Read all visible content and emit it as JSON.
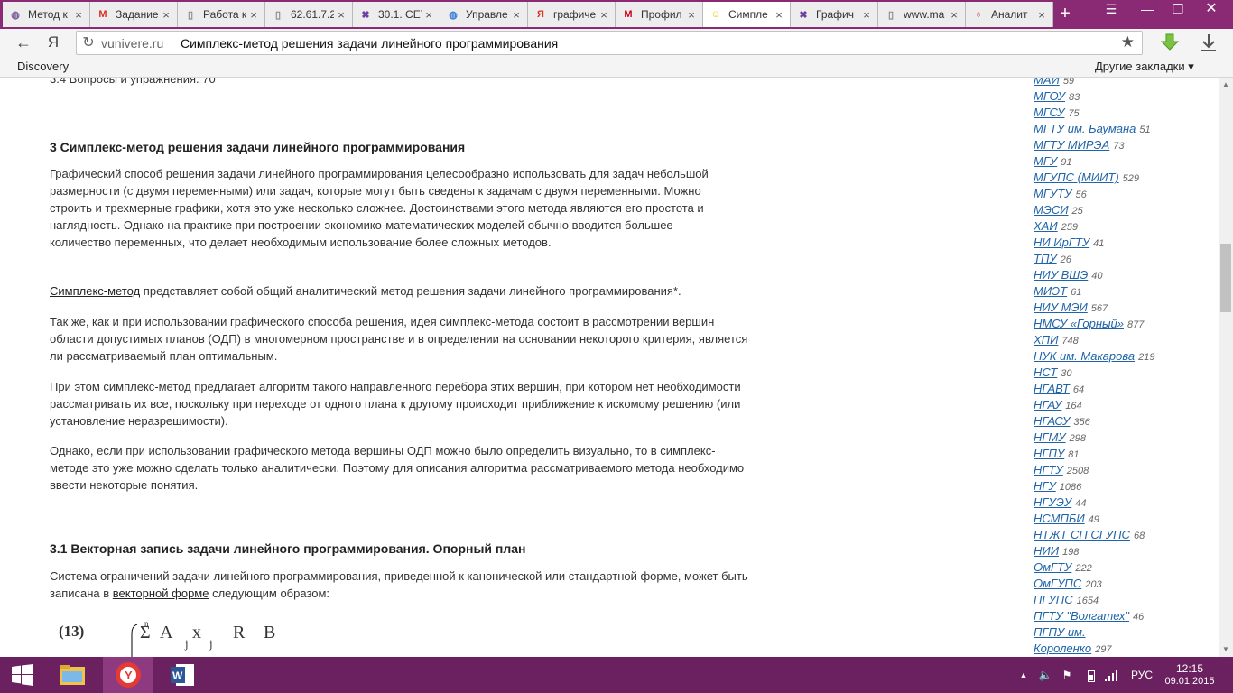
{
  "tabs": [
    {
      "label": "Метод к",
      "icon": "globe-icon",
      "icon_color": "#7a5a9a"
    },
    {
      "label": "Задание",
      "icon": "gmail-icon",
      "icon_color": "#d93025"
    },
    {
      "label": "Работа к",
      "icon": "page-icon",
      "icon_color": "#888888"
    },
    {
      "label": "62.61.7.2",
      "icon": "page-icon",
      "icon_color": "#888888"
    },
    {
      "label": "30.1. СЕТ",
      "icon": "x-brand-icon",
      "icon_color": "#6a3fa0"
    },
    {
      "label": "Управле",
      "icon": "globe-icon",
      "icon_color": "#3a7bd5"
    },
    {
      "label": "графиче",
      "icon": "yandex-icon",
      "icon_color": "#d9342b"
    },
    {
      "label": "Профил",
      "icon": "m-brand-icon",
      "icon_color": "#d0021b"
    },
    {
      "label": "Симпле",
      "icon": "smiley-icon",
      "icon_color": "#f2c200",
      "active": true
    },
    {
      "label": "Графич",
      "icon": "x-brand-icon",
      "icon_color": "#6a3fa0"
    },
    {
      "label": "www.ma",
      "icon": "page-icon",
      "icon_color": "#888888"
    },
    {
      "label": "Аналит",
      "icon": "mouse-icon",
      "icon_color": "#c62828"
    }
  ],
  "toolbar": {
    "back": "←",
    "yandex_letter": "Я",
    "refresh": "↻",
    "domain": "vunivere.ru",
    "page_title": "Симплекс-метод решения задачи линейного программирования",
    "star": "★"
  },
  "bookmarks": {
    "left": "Discovery",
    "right": "Другие закладки ▾"
  },
  "article": {
    "top_partial": "3.4 Вопросы и упражнения. 70",
    "h1": "3 Симплекс-метод решения задачи линейного программирования",
    "p1": "Графический способ решения задачи линейного программирования целесообразно использовать для задач небольшой размерности (с двумя переменными) или задач, которые могут быть сведены к задачам с двумя переменными. Можно строить и трехмерные графики, хотя это уже несколько сложнее. Достоинствами этого метода являются его простота и наглядность. Однако на практике при построении экономико-математических моделей обычно вводится большее количество переменных, что делает необходимым использование более сложных методов.",
    "p2_link": "Симплекс-метод",
    "p2_rest": " представляет собой общий аналитический метод решения задачи линейного программирования*.",
    "p3": "Так же, как и при использовании графического способа решения, идея симплекс-метода состоит в рассмотрении вершин области допустимых планов (ОДП) в многомерном пространстве и в определении на основании некоторого критерия, является ли рассматриваемый план оптимальным.",
    "p4": "При этом симплекс-метод предлагает алгоритм такого направленного перебора этих вершин, при котором нет необходимости рассматривать их все, поскольку при переходе от одного плана к другому происходит приближение к искомому решению (или установление неразрешимости).",
    "p5": "Однако, если при использовании графического метода вершины ОДП можно было определить визуально, то в симплекс-методе это уже можно сделать только аналитически. Поэтому для описания алгоритма рассматриваемого метода необходимо ввести некоторые понятия.",
    "h2": "3.1 Векторная запись задачи линейного программирования. Опорный план",
    "p6_pre": "Система ограничений задачи линейного программирования, приведенной к канонической или стандартной форме, может быть записана в ",
    "p6_link": "векторной форме",
    "p6_post": " следующим образом:",
    "formula": {
      "num": "(13)",
      "n": "n",
      "sigma": "Σ",
      "a": "A",
      "j1": "j",
      "x": "x",
      "j2": "j",
      "r": "R",
      "b": "B"
    }
  },
  "sidebar": [
    {
      "name": "МАИ",
      "count": "59"
    },
    {
      "name": "МГОУ",
      "count": "83"
    },
    {
      "name": "МГСУ",
      "count": "75"
    },
    {
      "name": "МГТУ им. Баумана",
      "count": "51"
    },
    {
      "name": "МГТУ МИРЭА",
      "count": "73"
    },
    {
      "name": "МГУ",
      "count": "91"
    },
    {
      "name": "МГУПС (МИИТ)",
      "count": "529"
    },
    {
      "name": "МГУТУ",
      "count": "56"
    },
    {
      "name": "МЭСИ",
      "count": "25"
    },
    {
      "name": "ХАИ",
      "count": "259"
    },
    {
      "name": "НИ ИрГТУ",
      "count": "41"
    },
    {
      "name": "ТПУ",
      "count": "26"
    },
    {
      "name": "НИУ ВШЭ",
      "count": "40"
    },
    {
      "name": "МИЭТ",
      "count": "61"
    },
    {
      "name": "НИУ МЭИ",
      "count": "567"
    },
    {
      "name": "НМСУ «Горный»",
      "count": "877"
    },
    {
      "name": "ХПИ",
      "count": "748"
    },
    {
      "name": "НУК им. Макарова",
      "count": "219"
    },
    {
      "name": "НСТ",
      "count": "30"
    },
    {
      "name": "НГАВТ",
      "count": "64"
    },
    {
      "name": "НГАУ",
      "count": "164"
    },
    {
      "name": "НГАСУ",
      "count": "356"
    },
    {
      "name": "НГМУ",
      "count": "298"
    },
    {
      "name": "НГПУ",
      "count": "81"
    },
    {
      "name": "НГТУ",
      "count": "2508"
    },
    {
      "name": "НГУ",
      "count": "1086"
    },
    {
      "name": "НГУЭУ",
      "count": "44"
    },
    {
      "name": "НСМПБИ",
      "count": "49"
    },
    {
      "name": "НТЖТ СП СГУПС",
      "count": "68"
    },
    {
      "name": "НИИ",
      "count": "198"
    },
    {
      "name": "ОмГТУ",
      "count": "222"
    },
    {
      "name": "ОмГУПС",
      "count": "203"
    },
    {
      "name": "ПГУПС",
      "count": "1654"
    },
    {
      "name": "ПГТУ \"Волгатех\"",
      "count": "46"
    },
    {
      "name": "ПГПУ им.",
      "count": ""
    },
    {
      "name": "Короленко",
      "count": "297"
    }
  ],
  "taskbar": {
    "language": "РУС",
    "time": "12:15",
    "date": "09.01.2015"
  }
}
